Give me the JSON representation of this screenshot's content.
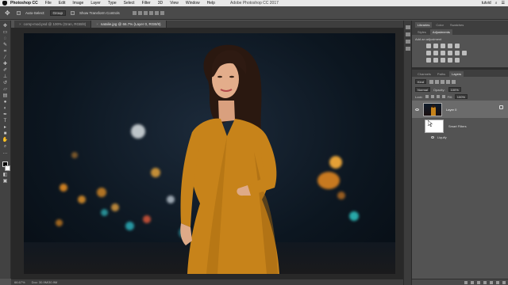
{
  "menubar": {
    "items": [
      "Photoshop CC",
      "File",
      "Edit",
      "Image",
      "Layer",
      "Type",
      "Select",
      "Filter",
      "3D",
      "View",
      "Window",
      "Help"
    ],
    "window_title": "Adobe Photoshop CC 2017",
    "user": "tutvid"
  },
  "options": {
    "auto_select_label": "Auto-Select:",
    "auto_select_value": "Group",
    "transform_label": "Show Transform Controls"
  },
  "doc_tabs": [
    {
      "label": "comp-mod.psd @ 100% (Gran, RGB/8)"
    },
    {
      "label": "natalie.jpg @ 66.7% (Layer 0, RGB/8)"
    }
  ],
  "status": {
    "zoom": "66.67%",
    "doc": "Doc: 30.9M/30.9M"
  },
  "right_panels": {
    "top_tabs": [
      "Libraries",
      "Color",
      "Swatches"
    ],
    "adj_tabs": [
      "Styles",
      "Adjustments"
    ],
    "adj_caption": "Add an adjustment",
    "layer_tabs": [
      "Channels",
      "Paths",
      "Layers"
    ],
    "kind": "Kind",
    "blend_mode": "Normal",
    "opacity_label": "Opacity:",
    "opacity_value": "100%",
    "lock_label": "Lock:",
    "fill_label": "Fill:",
    "fill_value": "100%",
    "layers": [
      {
        "name": "Layer 0"
      }
    ],
    "smart_filters_label": "Smart Filters",
    "filter_name": "Liquify"
  },
  "colors": {
    "accent_dress": "#c7831a",
    "app_bg": "#535353"
  }
}
